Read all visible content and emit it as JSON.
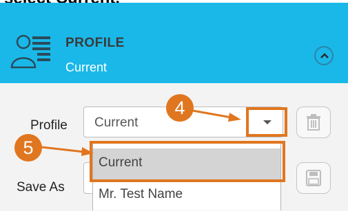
{
  "caption": "select Current.",
  "header": {
    "title": "PROFILE",
    "subtitle": "Current",
    "icon": "profile-list-icon",
    "collapse_icon": "chevron-up-icon"
  },
  "profile_row": {
    "label": "Profile",
    "selected_value": "Current",
    "delete_icon": "trash-icon"
  },
  "dropdown": {
    "options": [
      "Current",
      "Mr. Test Name"
    ],
    "highlighted": "Current"
  },
  "save_row": {
    "label": "Save As",
    "save_icon": "floppy-disk-icon"
  },
  "callouts": {
    "step_4": "4",
    "step_5": "5"
  },
  "colors": {
    "header_bg": "#1ab8e8",
    "callout": "#e0761f",
    "panel_bg": "#f3f3f3"
  }
}
